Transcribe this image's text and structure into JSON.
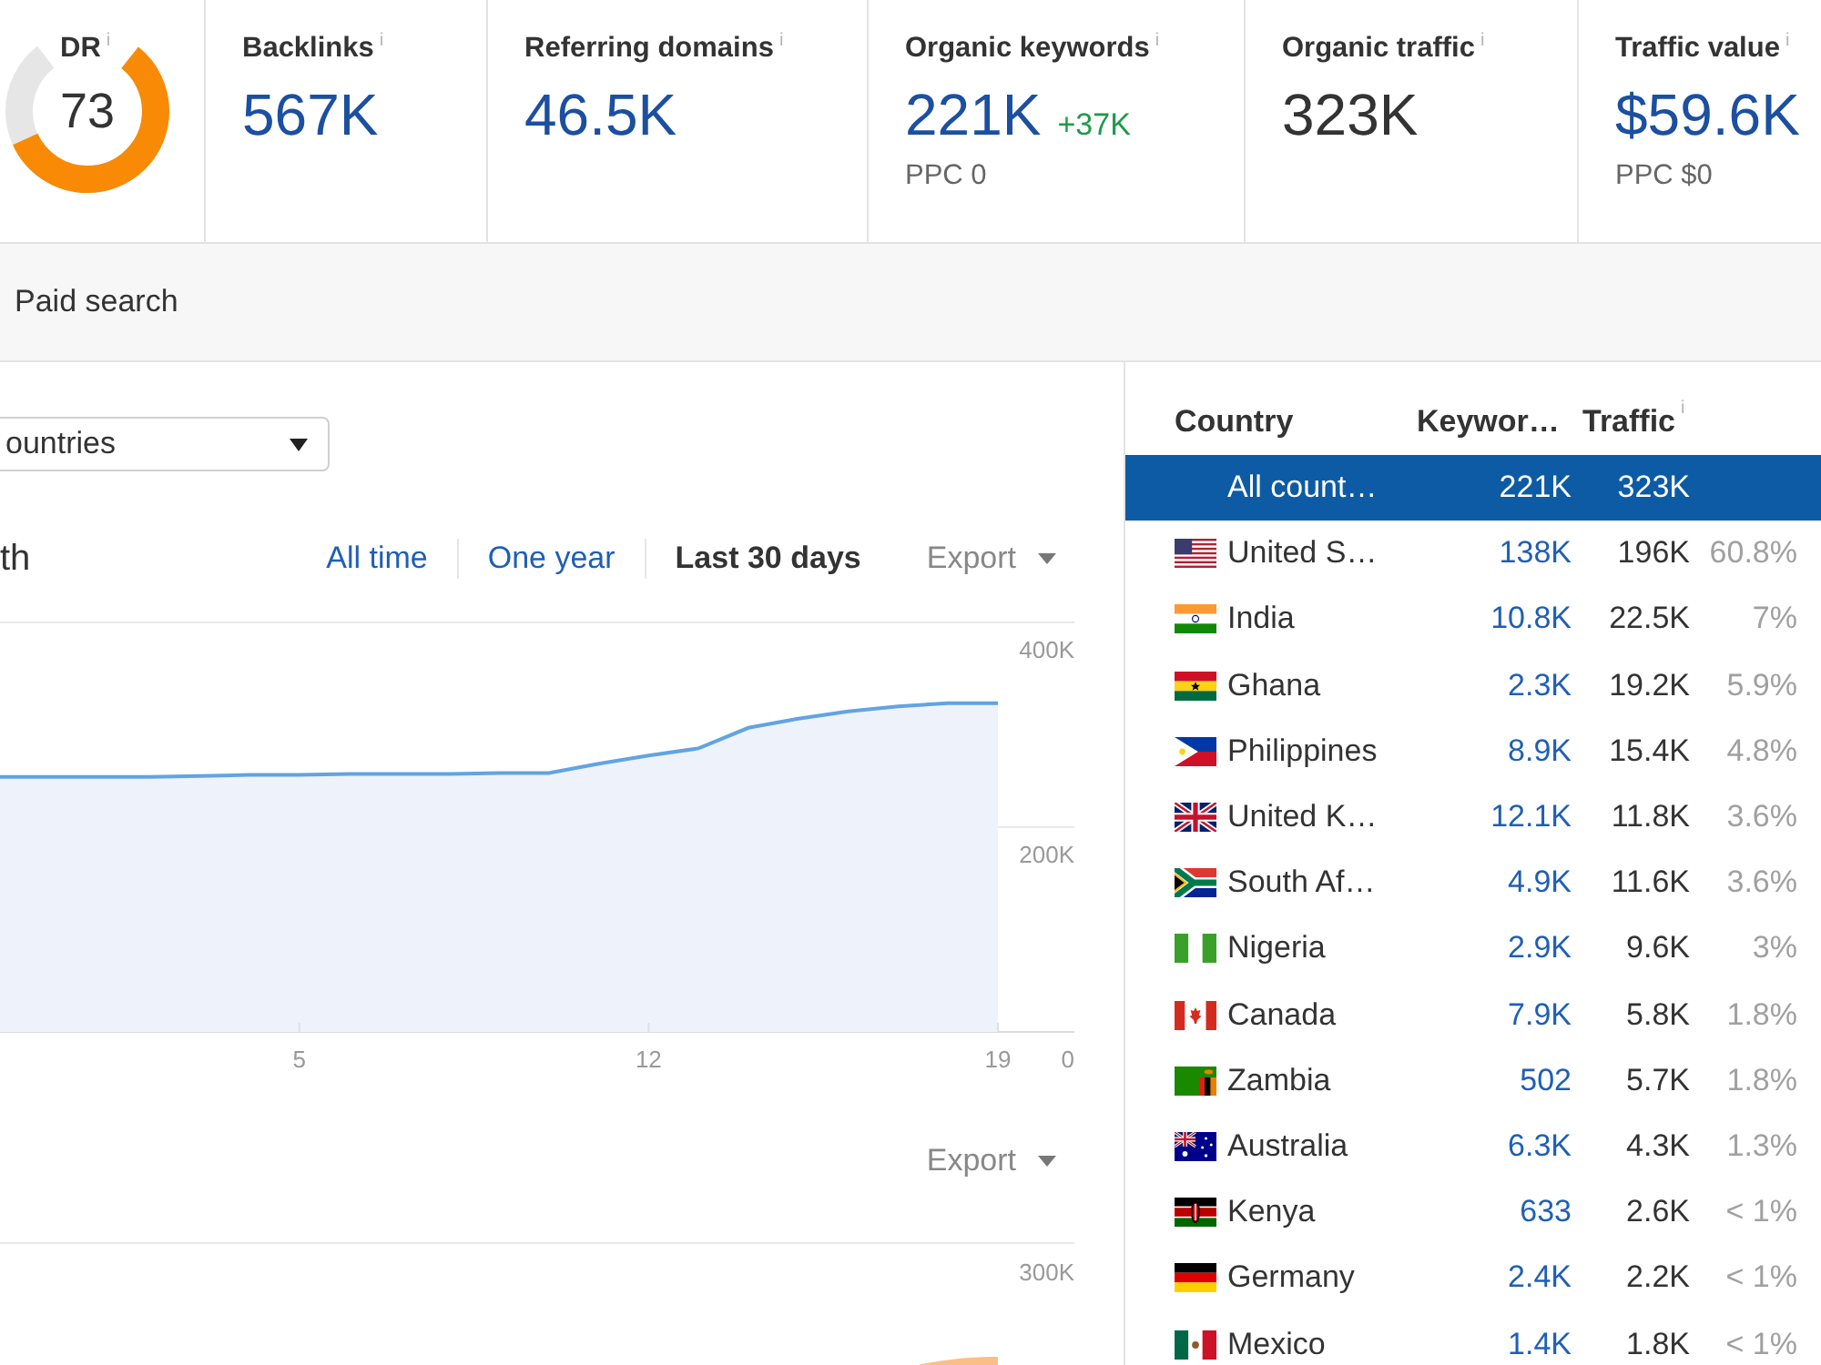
{
  "domain_rating": {
    "label": "DR",
    "info": "i",
    "value": "73",
    "level": 0.73
  },
  "metrics": [
    {
      "label": "Backlinks",
      "info": "i",
      "value": "567K",
      "linked": true
    },
    {
      "label": "Referring domains",
      "info": "i",
      "value": "46.5K",
      "linked": true
    },
    {
      "label": "Organic keywords",
      "info": "i",
      "value": "221K",
      "linked": true,
      "change": "+37K",
      "sub": "PPC 0"
    },
    {
      "label": "Organic traffic",
      "info": "i",
      "value": "323K",
      "linked": false
    },
    {
      "label": "Traffic value",
      "info": "i",
      "value": "$59.6K",
      "linked": true,
      "sub": "PPC $0"
    }
  ],
  "tabs": [
    {
      "label": "Paid search",
      "selected": false
    }
  ],
  "country_filter": {
    "value": "ountries"
  },
  "traffic_chart": {
    "title": "th",
    "periods": [
      {
        "label": "All time",
        "selected": false
      },
      {
        "label": "One year",
        "selected": false
      },
      {
        "label": "Last 30 days",
        "selected": true
      }
    ],
    "export": "Export",
    "chart_data": {
      "type": "area",
      "x": [
        -1,
        0,
        1,
        2,
        3,
        4,
        5,
        6,
        7,
        8,
        9,
        10,
        11,
        12,
        13,
        14,
        15,
        16,
        17,
        18,
        19
      ],
      "values": [
        249000,
        249000,
        249000,
        249000,
        250000,
        251000,
        251000,
        252000,
        252000,
        252000,
        253000,
        253000,
        262000,
        270000,
        277000,
        297000,
        306000,
        313000,
        318000,
        321000,
        321000
      ],
      "xlim": [
        -1,
        19
      ],
      "ylim": [
        0,
        400000
      ],
      "xticks": [
        5,
        12,
        19
      ],
      "yticks": [
        {
          "value": 0,
          "label": "0"
        },
        {
          "value": 200000,
          "label": "200K"
        },
        {
          "value": 400000,
          "label": "400K"
        }
      ]
    }
  },
  "second_chart": {
    "export": "Export",
    "axis_label": "300K"
  },
  "country_table": {
    "columns": [
      {
        "label": "Country"
      },
      {
        "label": "Keywor…"
      },
      {
        "label": "Traffic",
        "info": "i"
      }
    ],
    "rows": [
      {
        "kind": "all",
        "country": "All count…",
        "keywords": "221K",
        "traffic": "323K",
        "selected": true
      },
      {
        "kind": "us",
        "country": "United S…",
        "keywords": "138K",
        "traffic": "196K",
        "share": "60.8%",
        "selected": false
      },
      {
        "kind": "in",
        "country": "India",
        "keywords": "10.8K",
        "traffic": "22.5K",
        "share": "7%",
        "selected": false
      },
      {
        "kind": "gh",
        "country": "Ghana",
        "keywords": "2.3K",
        "traffic": "19.2K",
        "share": "5.9%",
        "selected": false
      },
      {
        "kind": "ph",
        "country": "Philippines",
        "keywords": "8.9K",
        "traffic": "15.4K",
        "share": "4.8%",
        "selected": false
      },
      {
        "kind": "gb",
        "country": "United K…",
        "keywords": "12.1K",
        "traffic": "11.8K",
        "share": "3.6%",
        "selected": false
      },
      {
        "kind": "za",
        "country": "South Af…",
        "keywords": "4.9K",
        "traffic": "11.6K",
        "share": "3.6%",
        "selected": false
      },
      {
        "kind": "ng",
        "country": "Nigeria",
        "keywords": "2.9K",
        "traffic": "9.6K",
        "share": "3%",
        "selected": false
      },
      {
        "kind": "ca",
        "country": "Canada",
        "keywords": "7.9K",
        "traffic": "5.8K",
        "share": "1.8%",
        "selected": false
      },
      {
        "kind": "zm",
        "country": "Zambia",
        "keywords": "502",
        "traffic": "5.7K",
        "share": "1.8%",
        "selected": false
      },
      {
        "kind": "au",
        "country": "Australia",
        "keywords": "6.3K",
        "traffic": "4.3K",
        "share": "1.3%",
        "selected": false
      },
      {
        "kind": "ke",
        "country": "Kenya",
        "keywords": "633",
        "traffic": "2.6K",
        "share": "< 1%",
        "selected": false
      },
      {
        "kind": "de",
        "country": "Germany",
        "keywords": "2.4K",
        "traffic": "2.2K",
        "share": "< 1%",
        "selected": false
      },
      {
        "kind": "mx",
        "country": "Mexico",
        "keywords": "1.4K",
        "traffic": "1.8K",
        "share": "< 1%",
        "selected": false
      }
    ]
  }
}
